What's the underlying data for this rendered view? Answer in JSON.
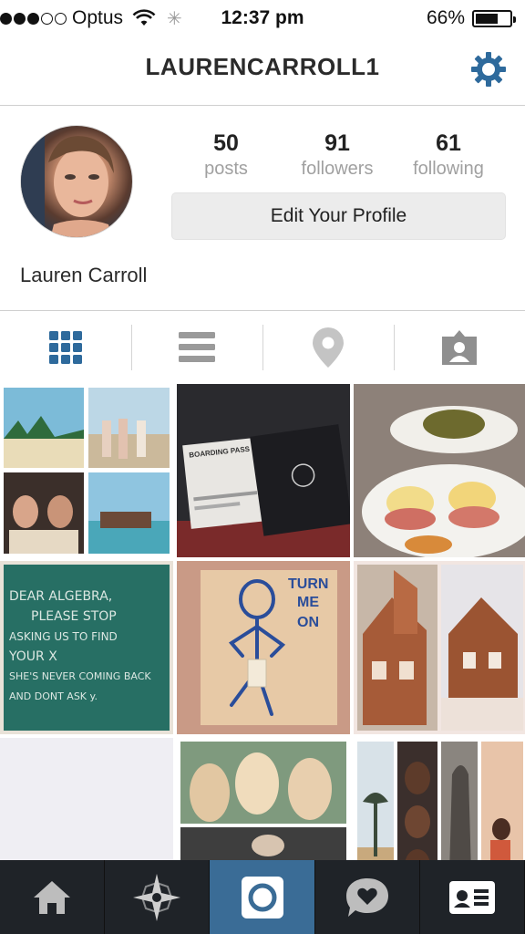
{
  "status_bar": {
    "carrier": "Optus",
    "time": "12:37 pm",
    "battery_label": "66%",
    "battery_level": 0.66,
    "signal_bars": 3,
    "signal_total": 5
  },
  "header": {
    "title": "LAURENCARROLL1",
    "settings_icon": "gear-icon"
  },
  "profile": {
    "full_name": "Lauren Carroll",
    "stats": [
      {
        "count": "50",
        "label": "posts"
      },
      {
        "count": "91",
        "label": "followers"
      },
      {
        "count": "61",
        "label": "following"
      }
    ],
    "edit_button_label": "Edit Your Profile"
  },
  "view_tabs": [
    {
      "name": "grid-view",
      "icon": "grid-icon",
      "active": true
    },
    {
      "name": "list-view",
      "icon": "list-icon",
      "active": false
    },
    {
      "name": "map-view",
      "icon": "location-pin-icon",
      "active": false
    },
    {
      "name": "tagged-view",
      "icon": "tagged-person-icon",
      "active": false
    }
  ],
  "photos": {
    "chalkboard_text": [
      "DEAR ALGEBRA,",
      "PLEASE STOP",
      "ASKING US TO FIND",
      "YOUR X",
      "SHE'S NEVER COMING BACK",
      "AND DONT ASK y."
    ],
    "stickman_text": [
      "TURN",
      "ME",
      "ON"
    ],
    "boarding_pass_text": "BOARDING PASS"
  },
  "bottom_nav": [
    {
      "name": "home",
      "icon": "home-icon",
      "active": false
    },
    {
      "name": "explore",
      "icon": "explore-star-icon",
      "active": false
    },
    {
      "name": "camera",
      "icon": "camera-icon",
      "active": true
    },
    {
      "name": "activity",
      "icon": "heart-bubble-icon",
      "active": false
    },
    {
      "name": "profile",
      "icon": "profile-card-icon",
      "active": false
    }
  ],
  "colors": {
    "accent_blue": "#2e6a9c",
    "nav_bg": "#1f2328",
    "nav_active": "#3a6c96",
    "icon_gray": "#9a9a9a"
  }
}
